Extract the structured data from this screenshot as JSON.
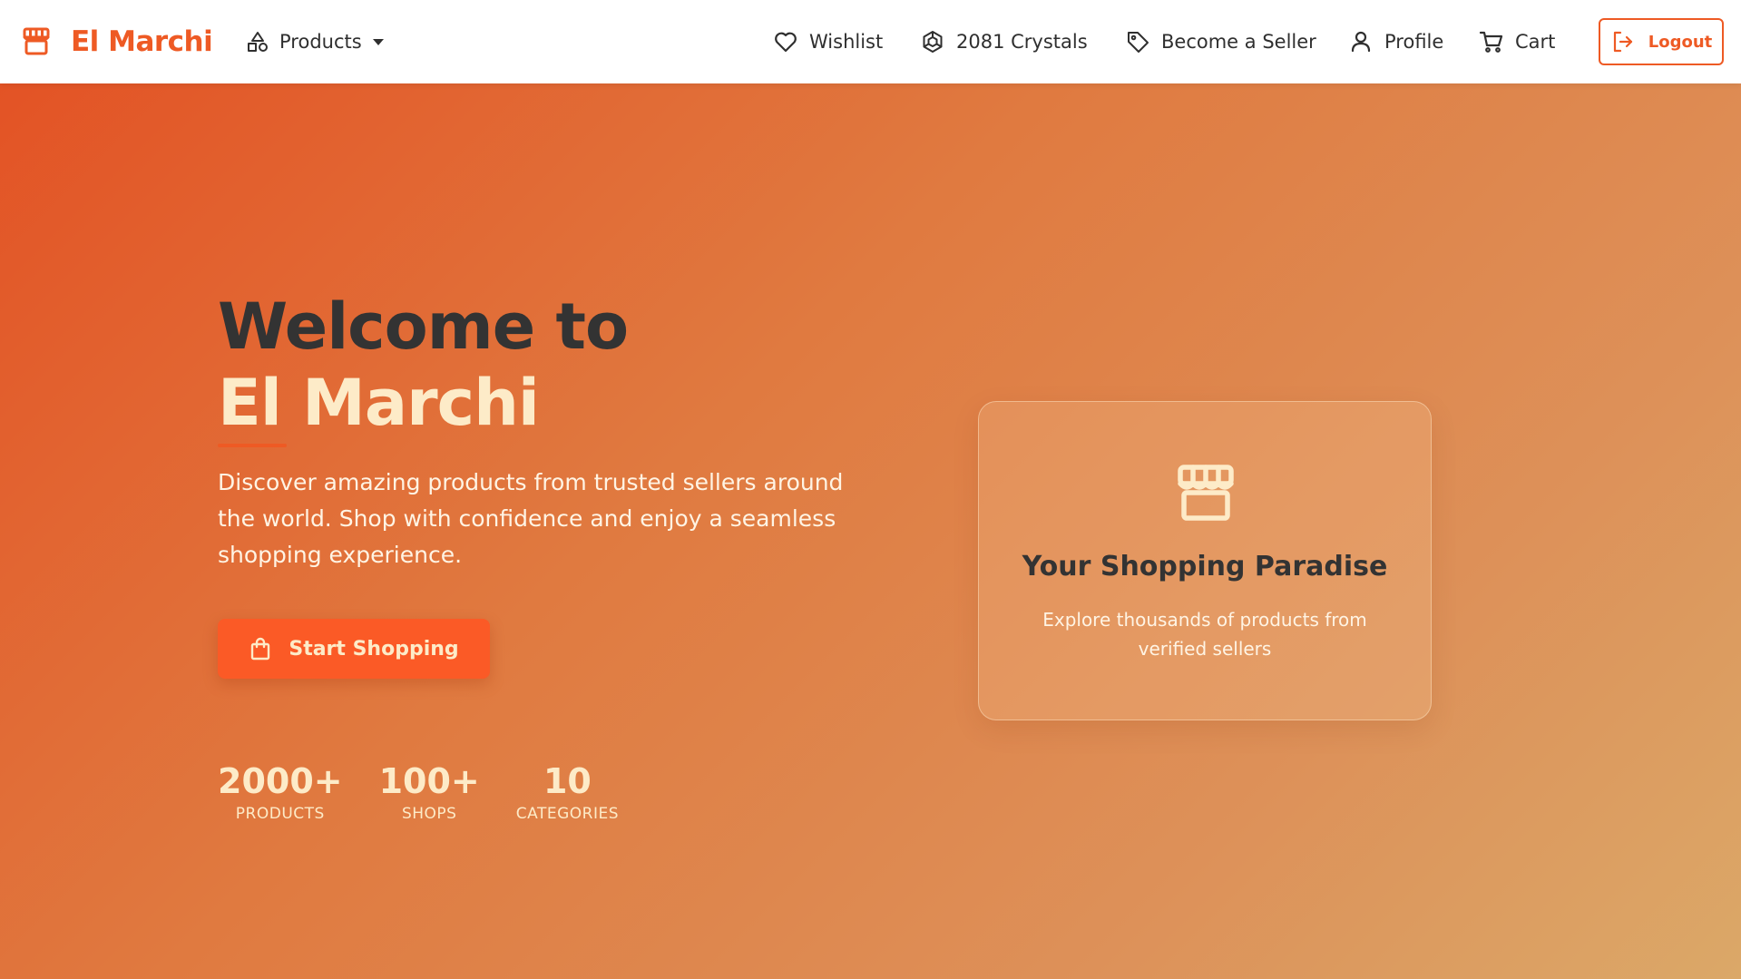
{
  "colors": {
    "brand": "#ee5a24",
    "text_dark": "#333333",
    "cream": "#fdebc8",
    "cta_bg": "#fb5a26"
  },
  "navbar": {
    "brand_name": "El Marchi",
    "brand_icon": "store-icon",
    "products": {
      "label": "Products",
      "icon": "shapes-icon"
    },
    "wishlist": {
      "label": "Wishlist",
      "icon": "heart-icon"
    },
    "crystals": {
      "label": "2081 Crystals",
      "icon": "crystal-icon"
    },
    "seller": {
      "label": "Become a Seller",
      "icon": "tag-icon"
    },
    "profile": {
      "label": "Profile",
      "icon": "user-icon"
    },
    "cart": {
      "label": "Cart",
      "icon": "cart-icon"
    },
    "logout": {
      "label": "Logout",
      "icon": "logout-icon"
    }
  },
  "hero": {
    "title_line1": "Welcome to",
    "title_line2": "El Marchi",
    "description": "Discover amazing products from trusted sellers around the world. Shop with confidence and enjoy a seamless shopping experience.",
    "cta_label": "Start Shopping",
    "cta_icon": "shopping-bag-icon",
    "stats": [
      {
        "value": "2000+",
        "label": "PRODUCTS"
      },
      {
        "value": "100+",
        "label": "SHOPS"
      },
      {
        "value": "10",
        "label": "CATEGORIES"
      }
    ]
  },
  "card": {
    "icon": "store-icon",
    "title": "Your Shopping Paradise",
    "subtitle": "Explore thousands of products from verified sellers"
  }
}
